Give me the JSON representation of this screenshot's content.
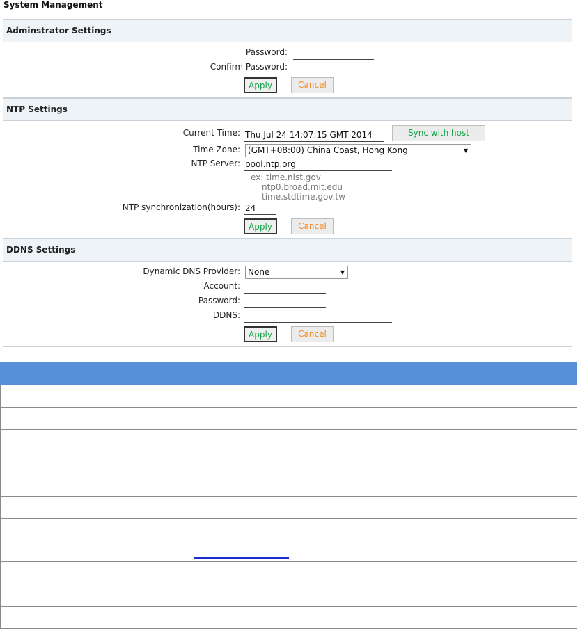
{
  "page": {
    "title": "System Management"
  },
  "admin": {
    "header": "Adminstrator Settings",
    "password_label": "Password:",
    "confirm_label": "Confirm Password:",
    "password_value": "",
    "confirm_value": "",
    "apply": "Apply",
    "cancel": "Cancel"
  },
  "ntp": {
    "header": "NTP Settings",
    "current_time_label": "Current Time:",
    "current_time_value": "Thu Jul 24 14:07:15 GMT 2014",
    "sync_button": "Sync with host",
    "timezone_label": "Time Zone:",
    "timezone_value": "(GMT+08:00) China Coast, Hong Kong",
    "server_label": "NTP Server:",
    "server_value": "pool.ntp.org",
    "examples": [
      "ex: time.nist.gov",
      "ntp0.broad.mit.edu",
      "time.stdtime.gov.tw"
    ],
    "sync_hours_label": "NTP synchronization(hours):",
    "sync_hours_value": "24",
    "apply": "Apply",
    "cancel": "Cancel"
  },
  "ddns": {
    "header": "DDNS Settings",
    "provider_label": "Dynamic DNS Provider:",
    "provider_value": "None",
    "account_label": "Account:",
    "password_label": "Password:",
    "ddns_label": "DDNS:",
    "account_value": "",
    "password_value": "",
    "ddns_value": "",
    "apply": "Apply",
    "cancel": "Cancel"
  },
  "colors": {
    "apply_text": "#16a34a",
    "cancel_text": "#f08a24",
    "table_header": "#5590d8",
    "link": "#1a2bd6"
  }
}
